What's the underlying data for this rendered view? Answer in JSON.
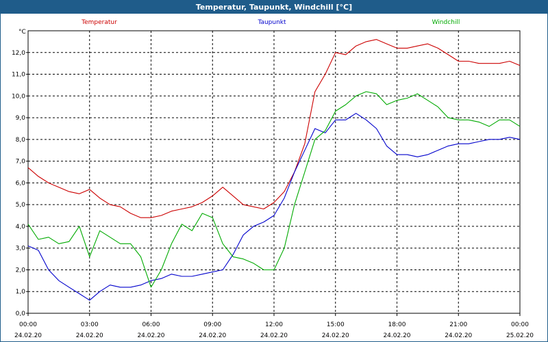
{
  "window": {
    "title": "Temperatur, Taupunkt, Windchill [°C]"
  },
  "colors": {
    "titlebar": "#1f5c8a",
    "grid": "#000000"
  },
  "chart_data": {
    "type": "line",
    "ylabel": "°C",
    "ylim": [
      0,
      13
    ],
    "yticks": [
      "0,0",
      "1,0",
      "2,0",
      "3,0",
      "4,0",
      "5,0",
      "6,0",
      "7,0",
      "8,0",
      "9,0",
      "10,0",
      "11,0",
      "12,0"
    ],
    "xlim": [
      0,
      24
    ],
    "xticks": [
      {
        "time": "00:00",
        "date": "24.02.20"
      },
      {
        "time": "03:00",
        "date": "24.02.20"
      },
      {
        "time": "06:00",
        "date": "24.02.20"
      },
      {
        "time": "09:00",
        "date": "24.02.20"
      },
      {
        "time": "12:00",
        "date": "24.02.20"
      },
      {
        "time": "15:00",
        "date": "24.02.20"
      },
      {
        "time": "18:00",
        "date": "24.02.20"
      },
      {
        "time": "21:00",
        "date": "24.02.20"
      },
      {
        "time": "00:00",
        "date": "25.02.20"
      }
    ],
    "grid": true,
    "series": [
      {
        "name": "Temperatur",
        "color": "#cc0000",
        "x": [
          0,
          0.5,
          1,
          1.5,
          2,
          2.5,
          3,
          3.5,
          4,
          4.5,
          5,
          5.5,
          6,
          6.5,
          7,
          7.5,
          8,
          8.5,
          9,
          9.5,
          10,
          10.5,
          11,
          11.5,
          12,
          12.5,
          13,
          13.5,
          14,
          14.5,
          15,
          15.5,
          16,
          16.5,
          17,
          17.5,
          18,
          18.5,
          19,
          19.5,
          20,
          20.5,
          21,
          21.5,
          22,
          22.5,
          23,
          23.5,
          24
        ],
        "values": [
          6.7,
          6.3,
          6.0,
          5.8,
          5.6,
          5.5,
          5.7,
          5.3,
          5.0,
          4.9,
          4.6,
          4.4,
          4.4,
          4.5,
          4.7,
          4.8,
          4.9,
          5.1,
          5.4,
          5.8,
          5.4,
          5.0,
          4.9,
          4.8,
          5.1,
          5.6,
          6.5,
          7.8,
          10.2,
          11.0,
          12.0,
          11.9,
          12.3,
          12.5,
          12.6,
          12.4,
          12.2,
          12.2,
          12.3,
          12.4,
          12.2,
          11.9,
          11.6,
          11.6,
          11.5,
          11.5,
          11.5,
          11.6,
          11.4
        ]
      },
      {
        "name": "Taupunkt",
        "color": "#0000cc",
        "x": [
          0,
          0.5,
          1,
          1.5,
          2,
          2.5,
          3,
          3.5,
          4,
          4.5,
          5,
          5.5,
          6,
          6.5,
          7,
          7.5,
          8,
          8.5,
          9,
          9.5,
          10,
          10.5,
          11,
          11.5,
          12,
          12.5,
          13,
          13.5,
          14,
          14.5,
          15,
          15.5,
          16,
          16.5,
          17,
          17.5,
          18,
          18.5,
          19,
          19.5,
          20,
          20.5,
          21,
          21.5,
          22,
          22.5,
          23,
          23.5,
          24
        ],
        "values": [
          3.1,
          2.9,
          2.0,
          1.5,
          1.2,
          0.9,
          0.6,
          1.0,
          1.3,
          1.2,
          1.2,
          1.3,
          1.5,
          1.6,
          1.8,
          1.7,
          1.7,
          1.8,
          1.9,
          2.0,
          2.7,
          3.6,
          4.0,
          4.2,
          4.5,
          5.3,
          6.5,
          7.5,
          8.5,
          8.3,
          8.9,
          8.9,
          9.2,
          8.9,
          8.5,
          7.7,
          7.3,
          7.3,
          7.2,
          7.3,
          7.5,
          7.7,
          7.8,
          7.8,
          7.9,
          8.0,
          8.0,
          8.1,
          8.0
        ]
      },
      {
        "name": "Windchill",
        "color": "#00aa00",
        "x": [
          0,
          0.5,
          1,
          1.5,
          2,
          2.5,
          3,
          3.5,
          4,
          4.5,
          5,
          5.5,
          6,
          6.5,
          7,
          7.5,
          8,
          8.5,
          9,
          9.5,
          10,
          10.5,
          11,
          11.5,
          12,
          12.5,
          13,
          13.5,
          14,
          14.5,
          15,
          15.5,
          16,
          16.5,
          17,
          17.5,
          18,
          18.5,
          19,
          19.5,
          20,
          20.5,
          21,
          21.5,
          22,
          22.5,
          23,
          23.5,
          24
        ],
        "values": [
          4.1,
          3.4,
          3.5,
          3.2,
          3.3,
          4.0,
          2.6,
          3.8,
          3.5,
          3.2,
          3.2,
          2.6,
          1.2,
          2.0,
          3.2,
          4.1,
          3.8,
          4.6,
          4.4,
          3.2,
          2.6,
          2.5,
          2.3,
          2.0,
          2.0,
          3.0,
          5.0,
          6.5,
          8.0,
          8.4,
          9.3,
          9.6,
          10.0,
          10.2,
          10.1,
          9.6,
          9.8,
          9.9,
          10.1,
          9.8,
          9.5,
          9.0,
          8.9,
          8.9,
          8.8,
          8.6,
          8.9,
          8.9,
          8.6
        ]
      }
    ]
  }
}
